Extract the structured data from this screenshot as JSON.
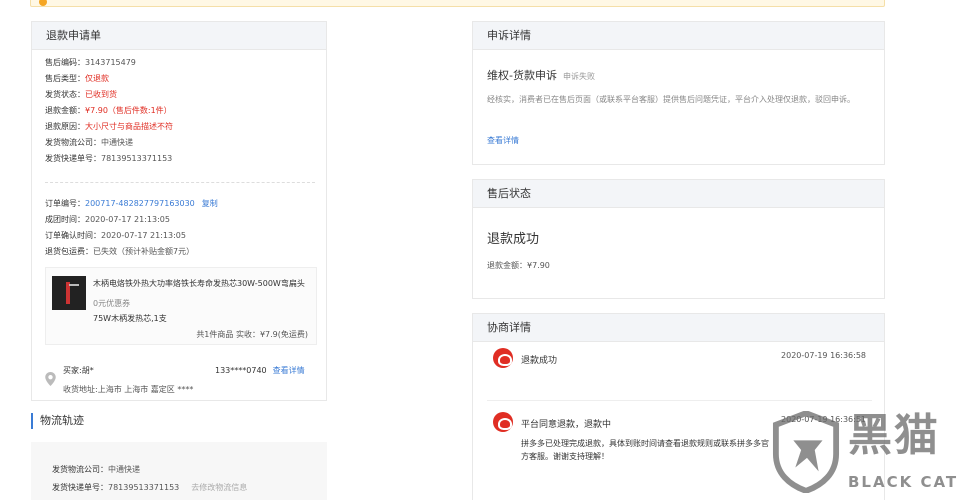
{
  "topbar": {
    "text": ""
  },
  "refund": {
    "title": "退款申请单",
    "aftersale_no_label": "售后编码：",
    "aftersale_no": "3143715479",
    "aftersale_type_label": "售后类型：",
    "aftersale_type": "仅退款",
    "ship_status_label": "发货状态：",
    "ship_status": "已收到货",
    "refund_amount_label": "退款金额：",
    "refund_amount": "¥7.90（售后件数:1件）",
    "reason_label": "退款原因：",
    "reason": "大小尺寸与商品描述不符",
    "carrier_label": "发货物流公司：",
    "carrier": "中通快递",
    "tracking_label": "发货快递单号：",
    "tracking": "78139513371153",
    "order_no_label": "订单编号：",
    "order_no": "200717-482827797163030",
    "copy": "复制",
    "deal_time_label": "成团时间：",
    "deal_time": "2020-07-17 21:13:05",
    "confirm_time_label": "订单确认时间：",
    "confirm_time": "2020-07-17 21:13:05",
    "package_label": "退货包运费：",
    "package": "已失效（预计补贴金额7元）"
  },
  "product": {
    "name": "木柄电烙铁外热大功率烙铁长寿命发热芯30W-500W弯扁头",
    "coupon": "0元优惠券",
    "spec": "75W木柄发热芯,1支",
    "summary": "共1件商品   实收：¥7.9(免运费)"
  },
  "buyer": {
    "name": "买家:胡*",
    "phone": "133****0740",
    "detail_link": "查看详情",
    "address": "收货地址:上海市 上海市 嘉定区 ****"
  },
  "logistics": {
    "title": "物流轨迹",
    "carrier_label": "发货物流公司：",
    "carrier": "中通快递",
    "tracking_label": "发货快递单号：",
    "tracking": "78139513371153",
    "edit": "去修改物流信息"
  },
  "appeal": {
    "header": "申诉详情",
    "title": "维权-货款申诉",
    "status": "申诉失败",
    "desc": "经核实，消费者已在售后页面（或联系平台客服）提供售后问题凭证，平台介入处理仅退款，驳回申诉。",
    "more": "查看详情"
  },
  "after_status": {
    "header": "售后状态",
    "status": "退款成功",
    "amount": "退款金额：¥7.90"
  },
  "negotiation": {
    "header": "协商详情",
    "items": [
      {
        "title": "退款成功",
        "time": "2020-07-19 16:36:58",
        "msg": ""
      },
      {
        "title": "平台同意退款，退款中",
        "time": "2020-07-19 16:36:51",
        "msg": "拼多多已处理完成退款，具体到账时间请查看退款规则或联系拼多多官方客服。谢谢支持理解！"
      }
    ]
  },
  "watermark": {
    "cn": "黑猫",
    "en": "BLACK CAT"
  },
  "colors": {
    "accent": "#3a7bd5",
    "red": "#e02e24",
    "header_bg": "#f3f5f8"
  }
}
